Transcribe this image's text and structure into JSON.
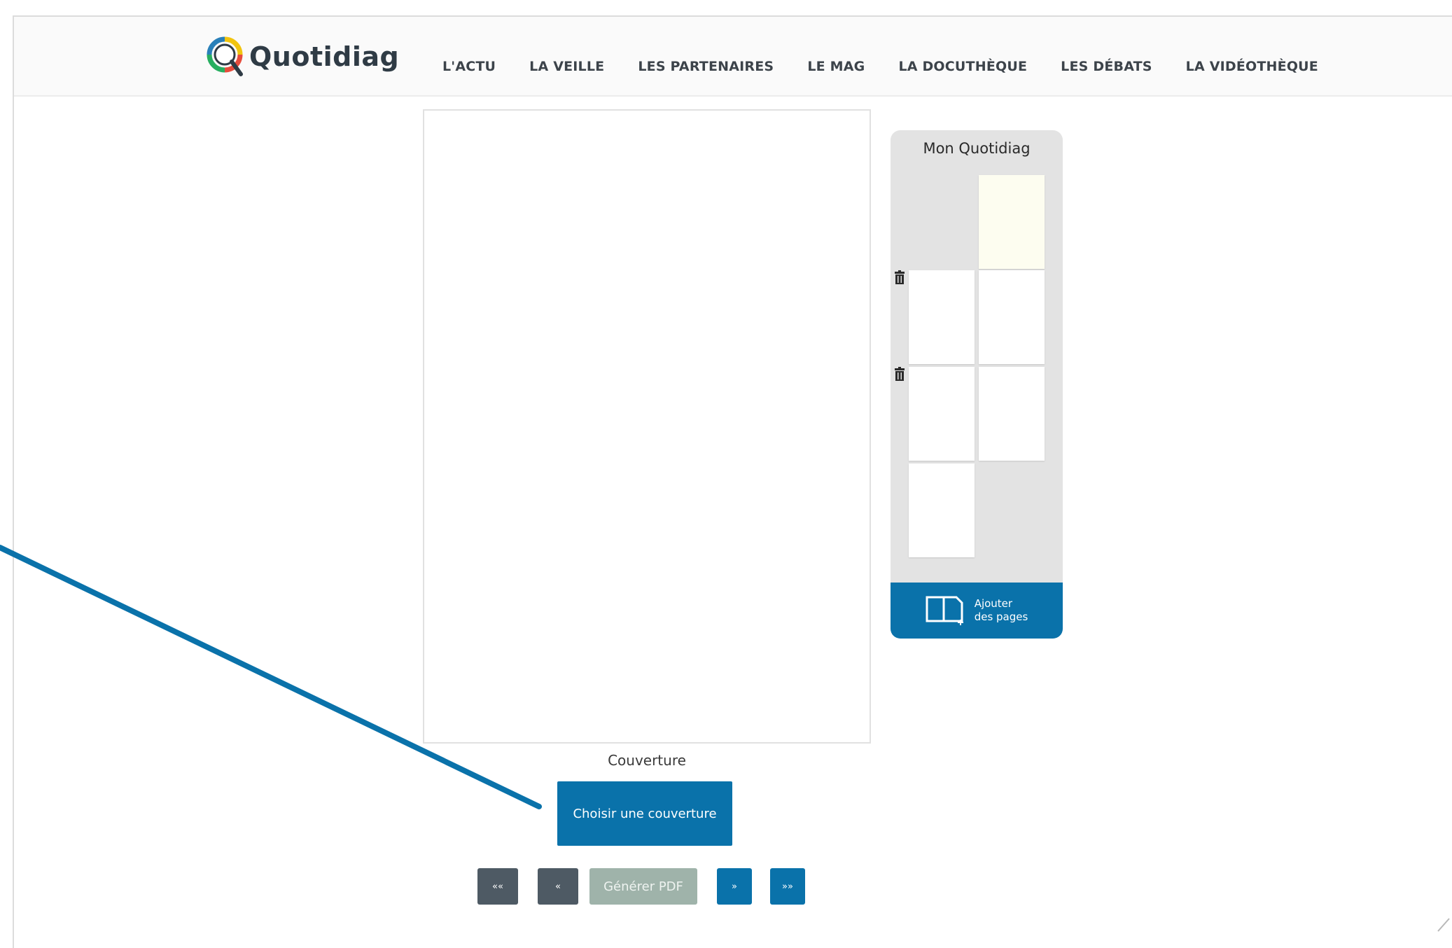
{
  "header": {
    "logo_text": "Quotidiag",
    "nav": [
      {
        "label": "L'ACTU"
      },
      {
        "label": "LA VEILLE"
      },
      {
        "label": "LES PARTENAIRES"
      },
      {
        "label": "LE MAG"
      },
      {
        "label": "LA DOCUTHÈQUE"
      },
      {
        "label": "LES DÉBATS"
      },
      {
        "label": "LA VIDÉOTHÈQUE"
      }
    ]
  },
  "editor": {
    "page_caption": "Couverture",
    "choose_cover_label": "Choisir une couverture",
    "pager": {
      "first_label": "««",
      "prev_label": "«",
      "generate_pdf_label": "Générer PDF",
      "next_label": "»",
      "last_label": "»»"
    }
  },
  "side_panel": {
    "title": "Mon Quotidiag",
    "add_pages_line1": "Ajouter",
    "add_pages_line2": "des pages"
  },
  "colors": {
    "accent": "#0a72aa",
    "pager_dark": "#4e5a64",
    "pdf_disabled": "#9fb3aa",
    "panel_bg": "#e3e3e3",
    "annotation_line": "#0a72aa"
  },
  "icons": {
    "logo": "magnifier-logo-icon",
    "trash": "trash-icon",
    "add_pages": "book-add-icon"
  }
}
